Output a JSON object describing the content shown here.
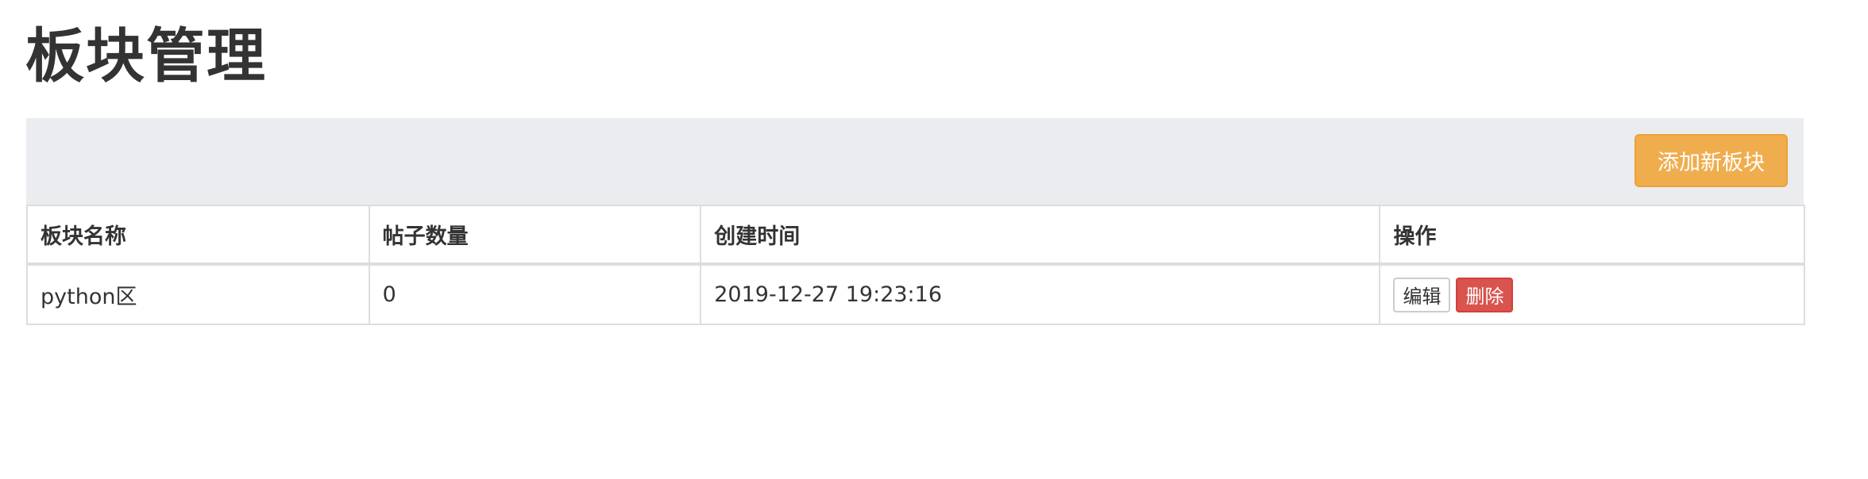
{
  "page": {
    "title": "板块管理"
  },
  "toolbar": {
    "add_label": "添加新板块"
  },
  "table": {
    "headers": {
      "name": "板块名称",
      "post_count": "帖子数量",
      "created_at": "创建时间",
      "actions": "操作"
    },
    "rows": [
      {
        "name": "python区",
        "post_count": "0",
        "created_at": "2019-12-27 19:23:16",
        "edit_label": "编辑",
        "delete_label": "删除"
      }
    ]
  },
  "colors": {
    "warning_button": "#f0ad4e",
    "danger_button": "#d9534f",
    "toolbar_background": "#ebecef",
    "text": "#333333",
    "border": "#dddddd"
  }
}
